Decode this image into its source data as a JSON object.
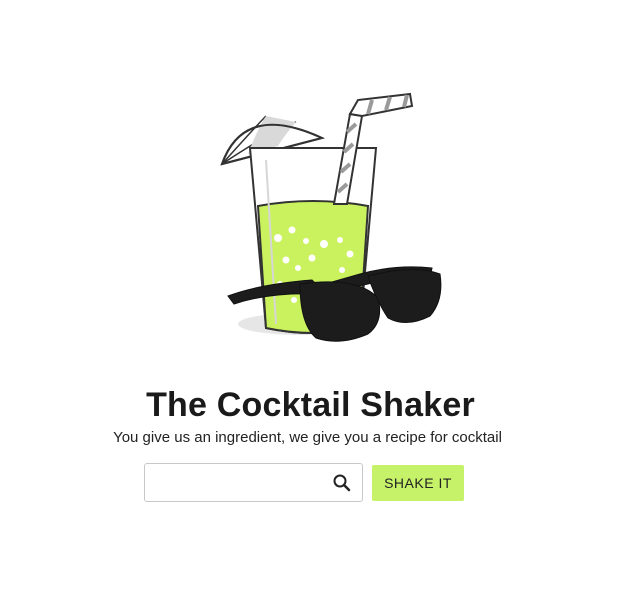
{
  "app": {
    "title": "The Cocktail Shaker",
    "tagline": "You give us an ingredient, we give you a recipe for cocktail"
  },
  "search": {
    "value": "",
    "placeholder": "",
    "icon": "search-icon"
  },
  "actions": {
    "shake_label": "SHAKE IT"
  },
  "colors": {
    "accent": "#c6f26a",
    "drink": "#c9f25e",
    "text": "#1a1a1a"
  },
  "illustration": {
    "items": [
      "cocktail-umbrella-icon",
      "straw-icon",
      "glass-icon",
      "sunglasses-icon"
    ]
  }
}
